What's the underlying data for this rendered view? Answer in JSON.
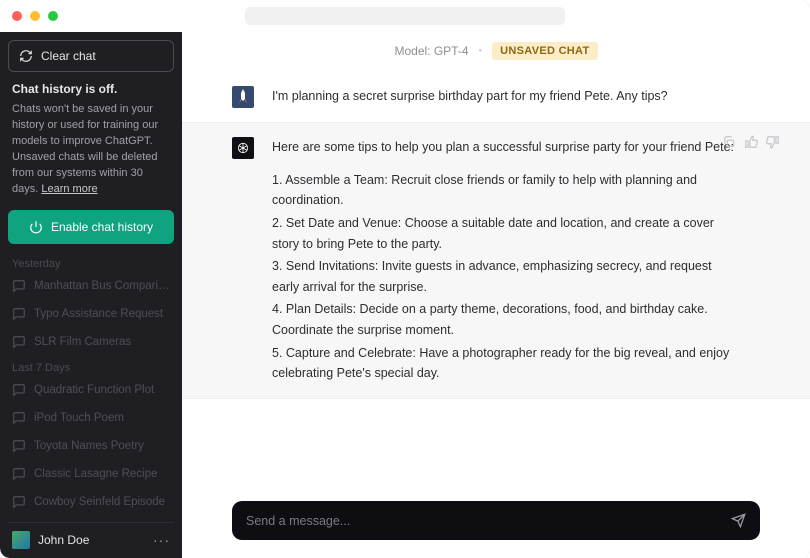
{
  "sidebar": {
    "clear_chat_label": "Clear chat",
    "history_title": "Chat history is off.",
    "history_desc_prefix": "Chats won't be saved in your history or used for training our models to improve ChatGPT. Unsaved chats will be deleted from our systems within 30 days. ",
    "learn_more": "Learn more",
    "enable_label": "Enable chat history",
    "sections": [
      {
        "label": "Yesterday",
        "items": [
          "Manhattan Bus Comparisons",
          "Typo Assistance Request",
          "SLR Film Cameras"
        ]
      },
      {
        "label": "Last 7 Days",
        "items": [
          "Quadratic Function Plot",
          "iPod Touch Poem",
          "Toyota Names Poetry",
          "Classic Lasagne Recipe",
          "Cowboy Seinfeld Episode"
        ]
      }
    ],
    "user_name": "John Doe"
  },
  "header": {
    "model_label": "Model: GPT-4",
    "unsaved_badge": "UNSAVED CHAT"
  },
  "messages": {
    "user_text": "I'm planning a secret surprise birthday part for my friend Pete. Any tips?",
    "assistant_intro": "Here are some tips to help you plan a successful surprise party for your friend Pete:",
    "assistant_list": [
      "1. Assemble a Team: Recruit close friends or family to help with planning and coordination.",
      "2. Set Date and Venue: Choose a suitable date and location, and create a cover story to bring Pete to the party.",
      "3. Send Invitations: Invite guests in advance, emphasizing secrecy, and request early arrival for the surprise.",
      "4. Plan Details: Decide on a party theme, decorations, food, and birthday cake. Coordinate the surprise moment.",
      "5. Capture and Celebrate: Have a photographer ready for the big reveal, and enjoy celebrating Pete's special day."
    ]
  },
  "input": {
    "placeholder": "Send a message..."
  }
}
